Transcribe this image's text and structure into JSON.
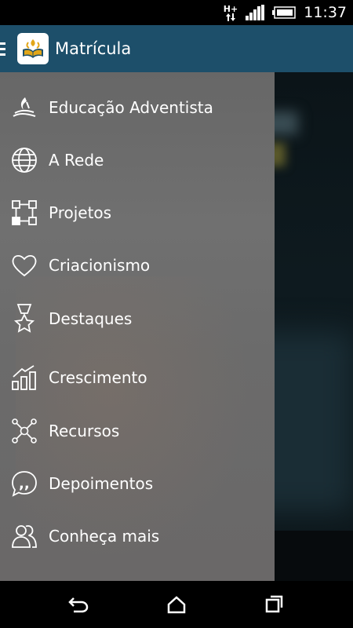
{
  "status_bar": {
    "network": "H+",
    "time": "11:37"
  },
  "app_bar": {
    "title": "Matrícula"
  },
  "menu": {
    "items": [
      {
        "label": "Educação Adventista",
        "icon": "adventist-flame-icon"
      },
      {
        "label": "A Rede",
        "icon": "globe-icon"
      },
      {
        "label": "Projetos",
        "icon": "projects-icon"
      },
      {
        "label": "Criacionismo",
        "icon": "heart-icon"
      },
      {
        "label": "Destaques",
        "icon": "medal-star-icon"
      },
      {
        "label": "Crescimento",
        "icon": "growth-chart-icon"
      },
      {
        "label": "Recursos",
        "icon": "network-nodes-icon"
      },
      {
        "label": "Depoimentos",
        "icon": "quote-bubble-icon"
      },
      {
        "label": "Conheça mais",
        "icon": "people-icon"
      }
    ]
  },
  "colors": {
    "app_bar": "#1d4f6a",
    "drawer": "#6b6b6b",
    "text": "#ffffff"
  }
}
